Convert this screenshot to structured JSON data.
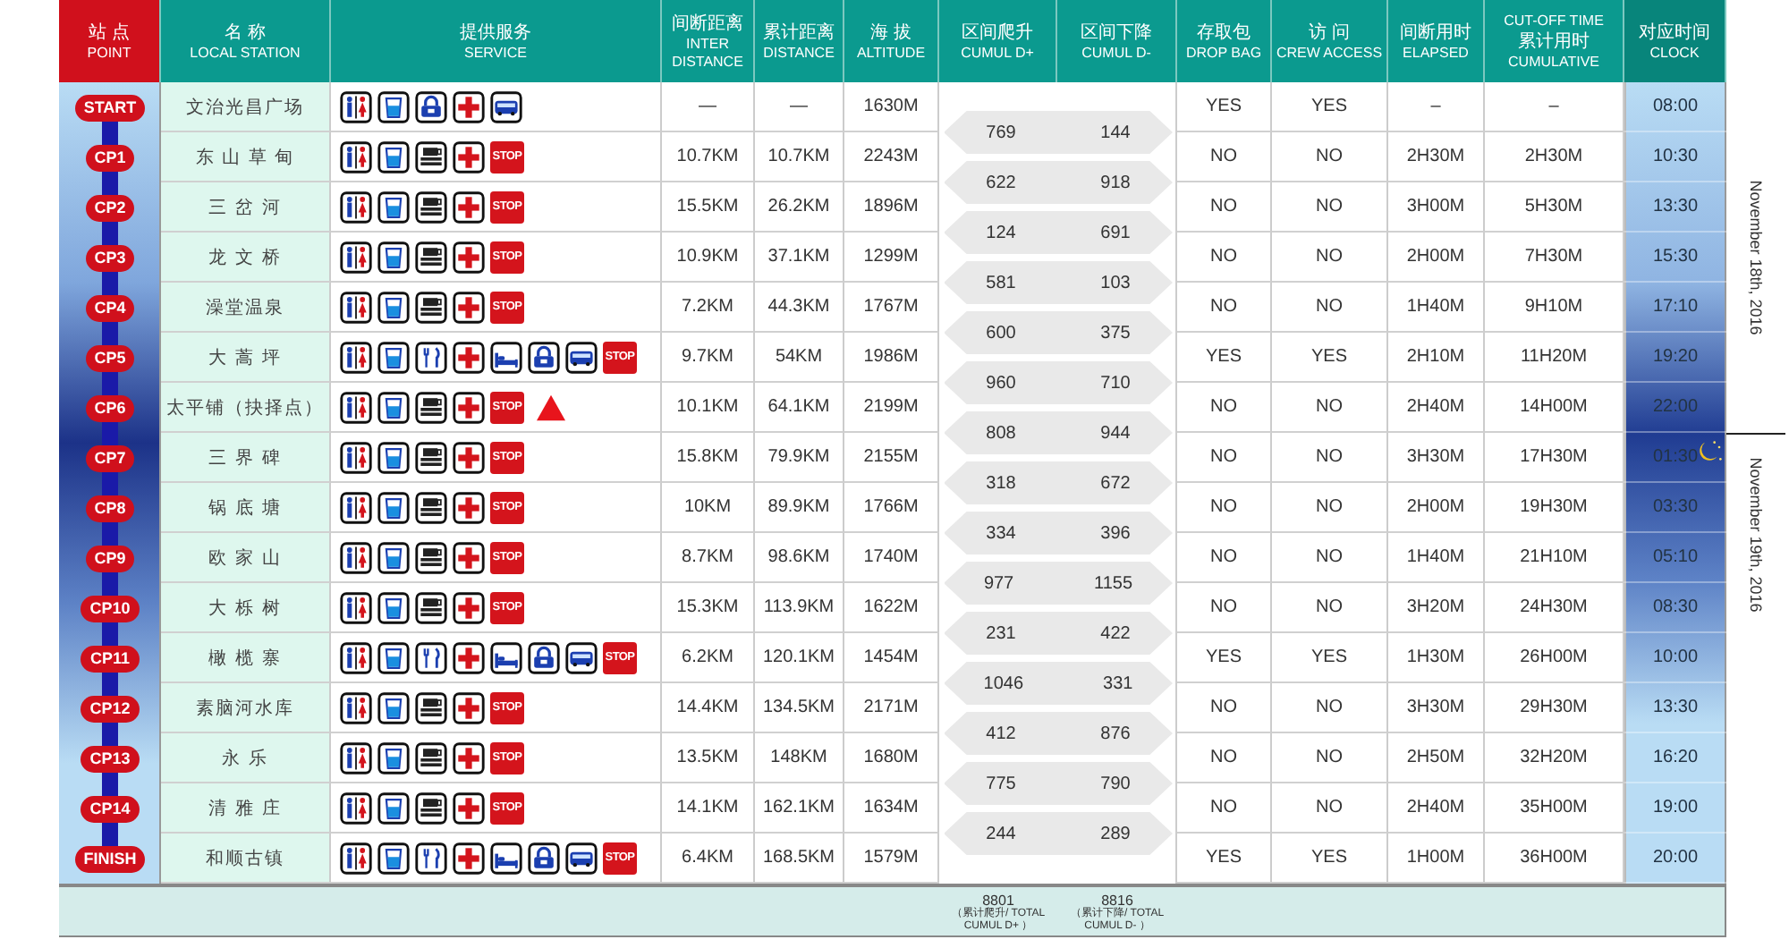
{
  "header": [
    {
      "kind": "point",
      "zh": "站 点",
      "en": "POINT"
    },
    {
      "kind": "plain",
      "zh": "名 称",
      "en": "LOCAL STATION"
    },
    {
      "kind": "plain",
      "zh": "提供服务",
      "en": "SERVICE"
    },
    {
      "kind": "plain",
      "zh": "间断距离",
      "en": "INTER DISTANCE"
    },
    {
      "kind": "plain",
      "zh": "累计距离",
      "en": "DISTANCE"
    },
    {
      "kind": "plain",
      "zh": "海 拔",
      "en": "ALTITUDE"
    },
    {
      "kind": "plain",
      "zh": "区间爬升",
      "en": "CUMUL D+"
    },
    {
      "kind": "plain",
      "zh": "区间下降",
      "en": "CUMUL D-"
    },
    {
      "kind": "plain",
      "zh": "存取包",
      "en": "DROP BAG"
    },
    {
      "kind": "plain",
      "zh": "访 问",
      "en": "CREW ACCESS"
    },
    {
      "kind": "plain",
      "zh": "间断用时",
      "en": "ELAPSED"
    },
    {
      "kind": "plain",
      "top": "CUT-OFF TIME",
      "zh": "累计用时",
      "en": "CUMULATIVE"
    },
    {
      "kind": "clock",
      "zh": "对应时间",
      "en": "CLOCK"
    }
  ],
  "rows": [
    {
      "point": "START",
      "name": "文治光昌广场",
      "services": [
        {
          "kind": "toilet"
        },
        {
          "kind": "water"
        },
        {
          "kind": "bag"
        },
        {
          "kind": "medical"
        },
        {
          "kind": "bus"
        }
      ],
      "inter": "—",
      "distance": "—",
      "altitude": "1630M",
      "drop_bag": "YES",
      "crew_access": "YES",
      "elapsed": "–",
      "cumulative": "–",
      "clock": "08:00"
    },
    {
      "point": "CP1",
      "name": "东 山 草 甸",
      "services": [
        {
          "kind": "toilet"
        },
        {
          "kind": "water"
        },
        {
          "kind": "hot-drink"
        },
        {
          "kind": "medical"
        },
        {
          "kind": "stop",
          "label": "STOP"
        }
      ],
      "inter": "10.7KM",
      "distance": "10.7KM",
      "altitude": "2243M",
      "drop_bag": "NO",
      "crew_access": "NO",
      "elapsed": "2H30M",
      "cumulative": "2H30M",
      "clock": "10:30"
    },
    {
      "point": "CP2",
      "name": "三 岔 河",
      "services": [
        {
          "kind": "toilet"
        },
        {
          "kind": "water"
        },
        {
          "kind": "hot-drink"
        },
        {
          "kind": "medical"
        },
        {
          "kind": "stop",
          "label": "STOP"
        }
      ],
      "inter": "15.5KM",
      "distance": "26.2KM",
      "altitude": "1896M",
      "drop_bag": "NO",
      "crew_access": "NO",
      "elapsed": "3H00M",
      "cumulative": "5H30M",
      "clock": "13:30"
    },
    {
      "point": "CP3",
      "name": "龙 文 桥",
      "services": [
        {
          "kind": "toilet"
        },
        {
          "kind": "water"
        },
        {
          "kind": "hot-drink"
        },
        {
          "kind": "medical"
        },
        {
          "kind": "stop",
          "label": "STOP"
        }
      ],
      "inter": "10.9KM",
      "distance": "37.1KM",
      "altitude": "1299M",
      "drop_bag": "NO",
      "crew_access": "NO",
      "elapsed": "2H00M",
      "cumulative": "7H30M",
      "clock": "15:30"
    },
    {
      "point": "CP4",
      "name": "澡堂温泉",
      "services": [
        {
          "kind": "toilet"
        },
        {
          "kind": "water"
        },
        {
          "kind": "hot-drink"
        },
        {
          "kind": "medical"
        },
        {
          "kind": "stop",
          "label": "STOP"
        }
      ],
      "inter": "7.2KM",
      "distance": "44.3KM",
      "altitude": "1767M",
      "drop_bag": "NO",
      "crew_access": "NO",
      "elapsed": "1H40M",
      "cumulative": "9H10M",
      "clock": "17:10"
    },
    {
      "point": "CP5",
      "name": "大 蒿 坪",
      "services": [
        {
          "kind": "toilet"
        },
        {
          "kind": "water"
        },
        {
          "kind": "utensils"
        },
        {
          "kind": "medical"
        },
        {
          "kind": "bed"
        },
        {
          "kind": "bag"
        },
        {
          "kind": "bus"
        },
        {
          "kind": "stop",
          "label": "STOP"
        }
      ],
      "inter": "9.7KM",
      "distance": "54KM",
      "altitude": "1986M",
      "drop_bag": "YES",
      "crew_access": "YES",
      "elapsed": "2H10M",
      "cumulative": "11H20M",
      "clock": "19:20"
    },
    {
      "point": "CP6",
      "name": "太平铺（抉择点）",
      "services": [
        {
          "kind": "toilet"
        },
        {
          "kind": "water"
        },
        {
          "kind": "hot-drink"
        },
        {
          "kind": "medical"
        },
        {
          "kind": "stop",
          "label": "STOP"
        },
        {
          "kind": "warning"
        }
      ],
      "inter": "10.1KM",
      "distance": "64.1KM",
      "altitude": "2199M",
      "drop_bag": "NO",
      "crew_access": "NO",
      "elapsed": "2H40M",
      "cumulative": "14H00M",
      "clock": "22:00"
    },
    {
      "point": "CP7",
      "name": "三 界 碑",
      "services": [
        {
          "kind": "toilet"
        },
        {
          "kind": "water"
        },
        {
          "kind": "hot-drink"
        },
        {
          "kind": "medical"
        },
        {
          "kind": "stop",
          "label": "STOP"
        }
      ],
      "clock_icon": {
        "kind": "moon"
      },
      "inter": "15.8KM",
      "distance": "79.9KM",
      "altitude": "2155M",
      "drop_bag": "NO",
      "crew_access": "NO",
      "elapsed": "3H30M",
      "cumulative": "17H30M",
      "clock": "01:30"
    },
    {
      "point": "CP8",
      "name": "锅 底 塘",
      "services": [
        {
          "kind": "toilet"
        },
        {
          "kind": "water"
        },
        {
          "kind": "hot-drink"
        },
        {
          "kind": "medical"
        },
        {
          "kind": "stop",
          "label": "STOP"
        }
      ],
      "inter": "10KM",
      "distance": "89.9KM",
      "altitude": "1766M",
      "drop_bag": "NO",
      "crew_access": "NO",
      "elapsed": "2H00M",
      "cumulative": "19H30M",
      "clock": "03:30"
    },
    {
      "point": "CP9",
      "name": "欧 家 山",
      "services": [
        {
          "kind": "toilet"
        },
        {
          "kind": "water"
        },
        {
          "kind": "hot-drink"
        },
        {
          "kind": "medical"
        },
        {
          "kind": "stop",
          "label": "STOP"
        }
      ],
      "inter": "8.7KM",
      "distance": "98.6KM",
      "altitude": "1740M",
      "drop_bag": "NO",
      "crew_access": "NO",
      "elapsed": "1H40M",
      "cumulative": "21H10M",
      "clock": "05:10"
    },
    {
      "point": "CP10",
      "name": "大 栎 树",
      "services": [
        {
          "kind": "toilet"
        },
        {
          "kind": "water"
        },
        {
          "kind": "hot-drink"
        },
        {
          "kind": "medical"
        },
        {
          "kind": "stop",
          "label": "STOP"
        }
      ],
      "inter": "15.3KM",
      "distance": "113.9KM",
      "altitude": "1622M",
      "drop_bag": "NO",
      "crew_access": "NO",
      "elapsed": "3H20M",
      "cumulative": "24H30M",
      "clock": "08:30"
    },
    {
      "point": "CP11",
      "name": "橄 榄 寨",
      "services": [
        {
          "kind": "toilet"
        },
        {
          "kind": "water"
        },
        {
          "kind": "utensils"
        },
        {
          "kind": "medical"
        },
        {
          "kind": "bed"
        },
        {
          "kind": "bag"
        },
        {
          "kind": "bus"
        },
        {
          "kind": "stop",
          "label": "STOP"
        }
      ],
      "inter": "6.2KM",
      "distance": "120.1KM",
      "altitude": "1454M",
      "drop_bag": "YES",
      "crew_access": "YES",
      "elapsed": "1H30M",
      "cumulative": "26H00M",
      "clock": "10:00"
    },
    {
      "point": "CP12",
      "name": "素脑河水库",
      "services": [
        {
          "kind": "toilet"
        },
        {
          "kind": "water"
        },
        {
          "kind": "hot-drink"
        },
        {
          "kind": "medical"
        },
        {
          "kind": "stop",
          "label": "STOP"
        }
      ],
      "inter": "14.4KM",
      "distance": "134.5KM",
      "altitude": "2171M",
      "drop_bag": "NO",
      "crew_access": "NO",
      "elapsed": "3H30M",
      "cumulative": "29H30M",
      "clock": "13:30"
    },
    {
      "point": "CP13",
      "name": "永 乐",
      "services": [
        {
          "kind": "toilet"
        },
        {
          "kind": "water"
        },
        {
          "kind": "hot-drink"
        },
        {
          "kind": "medical"
        },
        {
          "kind": "stop",
          "label": "STOP"
        }
      ],
      "inter": "13.5KM",
      "distance": "148KM",
      "altitude": "1680M",
      "drop_bag": "NO",
      "crew_access": "NO",
      "elapsed": "2H50M",
      "cumulative": "32H20M",
      "clock": "16:20"
    },
    {
      "point": "CP14",
      "name": "清 雅 庄",
      "services": [
        {
          "kind": "toilet"
        },
        {
          "kind": "water"
        },
        {
          "kind": "hot-drink"
        },
        {
          "kind": "medical"
        },
        {
          "kind": "stop",
          "label": "STOP"
        }
      ],
      "inter": "14.1KM",
      "distance": "162.1KM",
      "altitude": "1634M",
      "drop_bag": "NO",
      "crew_access": "NO",
      "elapsed": "2H40M",
      "cumulative": "35H00M",
      "clock": "19:00"
    },
    {
      "point": "FINISH",
      "name": "和顺古镇",
      "services": [
        {
          "kind": "toilet"
        },
        {
          "kind": "water"
        },
        {
          "kind": "utensils"
        },
        {
          "kind": "medical"
        },
        {
          "kind": "bed"
        },
        {
          "kind": "bag"
        },
        {
          "kind": "bus"
        },
        {
          "kind": "stop",
          "label": "STOP"
        }
      ],
      "inter": "6.4KM",
      "distance": "168.5KM",
      "altitude": "1579M",
      "drop_bag": "YES",
      "crew_access": "YES",
      "elapsed": "1H00M",
      "cumulative": "36H00M",
      "clock": "20:00"
    }
  ],
  "segments": [
    {
      "ascent": "769",
      "descent": "144"
    },
    {
      "ascent": "622",
      "descent": "918"
    },
    {
      "ascent": "124",
      "descent": "691"
    },
    {
      "ascent": "581",
      "descent": "103"
    },
    {
      "ascent": "600",
      "descent": "375"
    },
    {
      "ascent": "960",
      "descent": "710"
    },
    {
      "ascent": "808",
      "descent": "944"
    },
    {
      "ascent": "318",
      "descent": "672"
    },
    {
      "ascent": "334",
      "descent": "396"
    },
    {
      "ascent": "977",
      "descent": "1155"
    },
    {
      "ascent": "231",
      "descent": "422"
    },
    {
      "ascent": "1046",
      "descent": "331"
    },
    {
      "ascent": "412",
      "descent": "876"
    },
    {
      "ascent": "775",
      "descent": "790"
    },
    {
      "ascent": "244",
      "descent": "289"
    }
  ],
  "totals": [
    {
      "value": "8801",
      "note": "（累计爬升/ TOTAL CUMUL D+ ）"
    },
    {
      "value": "8816",
      "note": "（累计下降/ TOTAL CUMUL D- ）"
    }
  ],
  "dates": [
    {
      "label": "November 18th, 2016"
    },
    {
      "label": "November 19th, 2016"
    }
  ]
}
